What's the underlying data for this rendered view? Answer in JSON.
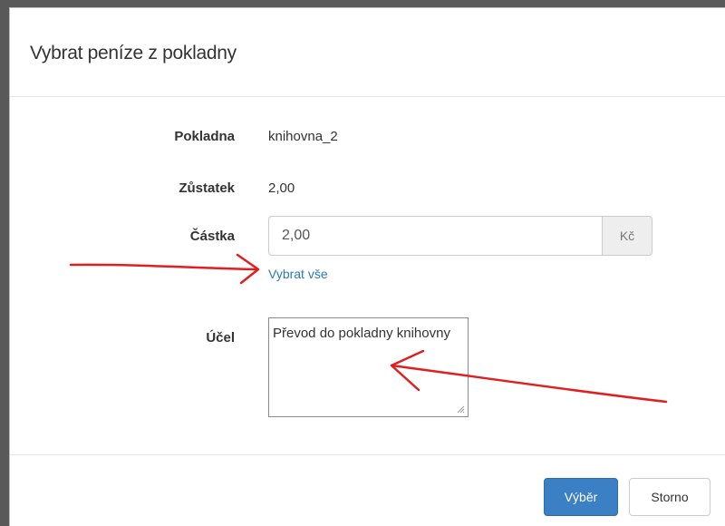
{
  "dialog": {
    "title": "Vybrat peníze z pokladny"
  },
  "form": {
    "cash_register_label": "Pokladna",
    "cash_register_value": "knihovna_2",
    "balance_label": "Zůstatek",
    "balance_value": "2,00",
    "amount_label": "Částka",
    "amount_value": "2,00",
    "currency": "Kč",
    "select_all_link": "Vybrat vše",
    "purpose_label": "Účel",
    "purpose_value": "Převod do pokladny knihovny"
  },
  "footer": {
    "withdraw_label": "Výběr",
    "cancel_label": "Storno"
  },
  "colors": {
    "primary": "#3b7fc4",
    "link": "#2a7ab8",
    "annotation": "#e02020"
  }
}
